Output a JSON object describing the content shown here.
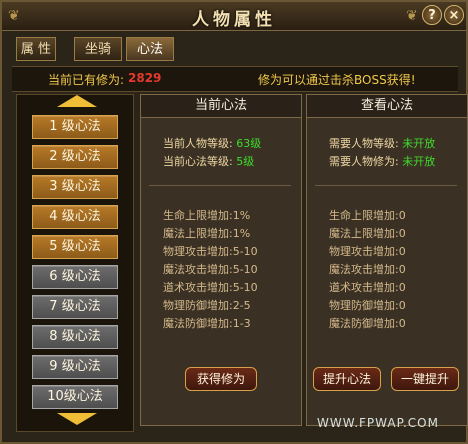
{
  "window": {
    "title": "人物属性",
    "help_label": "?",
    "close_label": "×"
  },
  "tabs": [
    {
      "label": "属 性",
      "active": false
    },
    {
      "label": "坐骑",
      "active": false
    },
    {
      "label": "心法",
      "active": true
    }
  ],
  "summary": {
    "current_cultivation_label": "当前已有修为:",
    "current_cultivation_value": "2829",
    "hint": "修为可以通过击杀BOSS获得!"
  },
  "levels": [
    {
      "label": "1 级心法",
      "state": "on"
    },
    {
      "label": "2 级心法",
      "state": "on"
    },
    {
      "label": "3 级心法",
      "state": "on"
    },
    {
      "label": "4 级心法",
      "state": "on"
    },
    {
      "label": "5 级心法",
      "state": "on"
    },
    {
      "label": "6 级心法",
      "state": "off"
    },
    {
      "label": "7 级心法",
      "state": "off"
    },
    {
      "label": "8 级心法",
      "state": "off"
    },
    {
      "label": "9 级心法",
      "state": "off"
    },
    {
      "label": "10级心法",
      "state": "off"
    }
  ],
  "current_panel": {
    "title": "当前心法",
    "char_level_label": "当前人物等级:",
    "char_level_value": "63级",
    "mind_level_label": "当前心法等级:",
    "mind_level_value": "5级",
    "stats": [
      {
        "label": "生命上限增加:",
        "value": "1%"
      },
      {
        "label": "魔法上限增加:",
        "value": "1%"
      },
      {
        "label": "物理攻击增加:",
        "value": "5-10"
      },
      {
        "label": "魔法攻击增加:",
        "value": "5-10"
      },
      {
        "label": "道术攻击增加:",
        "value": "5-10"
      },
      {
        "label": "物理防御增加:",
        "value": "2-5"
      },
      {
        "label": "魔法防御增加:",
        "value": "1-3"
      }
    ],
    "button": "获得修为"
  },
  "view_panel": {
    "title": "查看心法",
    "need_char_label": "需要人物等级:",
    "need_char_value": "未开放",
    "need_cult_label": "需要人物修为:",
    "need_cult_value": "未开放",
    "stats": [
      {
        "label": "生命上限增加:",
        "value": "0"
      },
      {
        "label": "魔法上限增加:",
        "value": "0"
      },
      {
        "label": "物理攻击增加:",
        "value": "0"
      },
      {
        "label": "魔法攻击增加:",
        "value": "0"
      },
      {
        "label": "道术攻击增加:",
        "value": "0"
      },
      {
        "label": "物理防御增加:",
        "value": "0"
      },
      {
        "label": "魔法防御增加:",
        "value": "0"
      }
    ],
    "button_upgrade": "提升心法",
    "button_auto": "一键提升"
  },
  "watermark": "WWW.FPWAP.COM"
}
